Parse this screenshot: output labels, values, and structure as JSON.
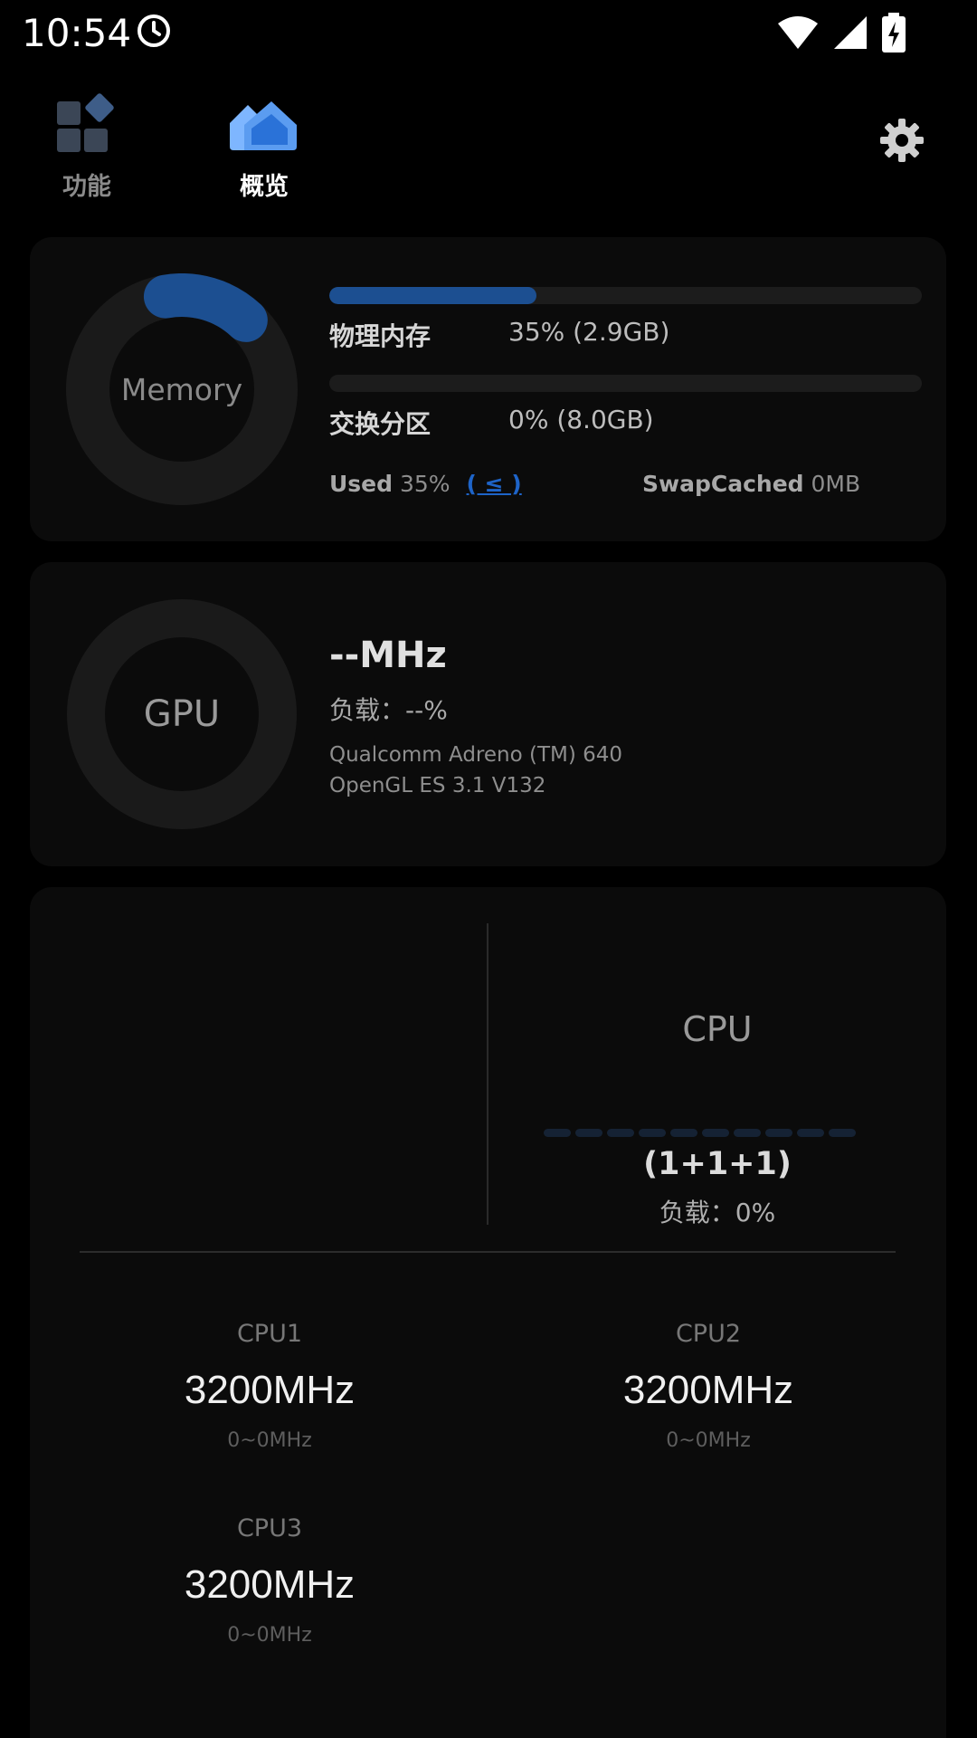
{
  "status_bar": {
    "time": "10:54"
  },
  "nav": {
    "tab_function": "功能",
    "tab_overview": "概览"
  },
  "memory": {
    "ring_label": "Memory",
    "ring_used_fraction": 0.35,
    "physical": {
      "label": "物理内存",
      "value": "35% (2.9GB)",
      "fraction": 0.35
    },
    "swap": {
      "label": "交换分区",
      "value": "0% (8.0GB)",
      "fraction": 0.0
    },
    "used_label": "Used",
    "used_value": "35%",
    "used_link": "( ≤ )",
    "swapcached_label": "SwapCached",
    "swapcached_value": "0MB"
  },
  "gpu": {
    "ring_label": "GPU",
    "freq": "--MHz",
    "load": "负载：--%",
    "model": "Qualcomm Adreno (TM) 640",
    "api": "OpenGL ES 3.1 V132"
  },
  "cpu": {
    "title": "CPU",
    "cores_summary": "(1+1+1)",
    "load": "负载：0%",
    "cores": [
      {
        "name": "CPU1",
        "freq": "3200MHz",
        "range": "0~0MHz"
      },
      {
        "name": "CPU2",
        "freq": "3200MHz",
        "range": "0~0MHz"
      },
      {
        "name": "CPU3",
        "freq": "3200MHz",
        "range": "0~0MHz"
      }
    ]
  },
  "colors": {
    "accent": "#1c4f91",
    "link": "#1e64c8",
    "card": "#0b0b0b"
  },
  "icons": [
    "clock-icon",
    "wifi-icon",
    "signal-icon",
    "battery-charging-icon",
    "grid-icon",
    "home-icon",
    "gear-icon"
  ]
}
